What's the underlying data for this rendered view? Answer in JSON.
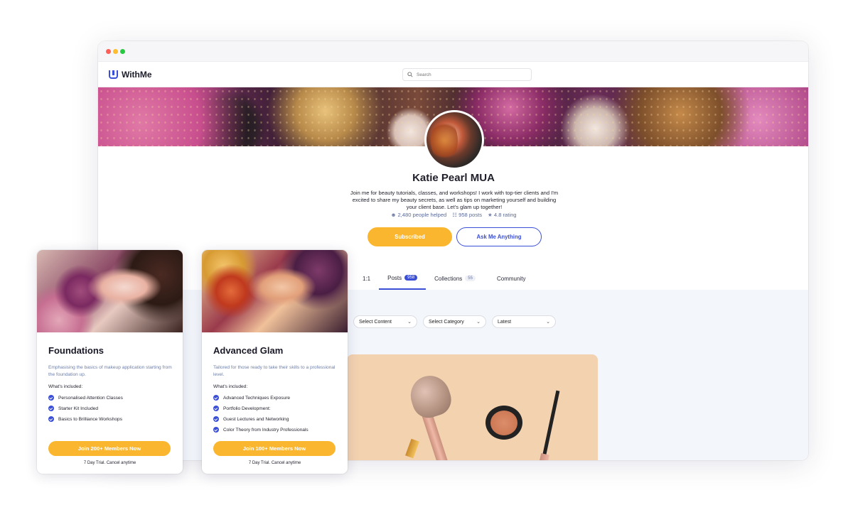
{
  "app": {
    "name": "WithMe"
  },
  "search": {
    "placeholder": "Search"
  },
  "profile": {
    "name": "Katie Pearl MUA",
    "bio": "Join me for beauty tutorials, classes, and workshops! I work with top-tier clients and I'm excited to share my beauty secrets, as well as tips on marketing yourself and building your client base. Let's glam up together!",
    "stats": {
      "helped": "2,480 people helped",
      "posts": "958 posts",
      "rating": "4.8 rating"
    }
  },
  "actions": {
    "subscribed": "Subscribed",
    "ask": "Ask Me Anything"
  },
  "tabs": [
    {
      "label": "1:1",
      "badge": ""
    },
    {
      "label": "Posts",
      "badge": "958"
    },
    {
      "label": "Collections",
      "badge": "55"
    },
    {
      "label": "Community",
      "badge": ""
    }
  ],
  "filters": {
    "content": "Select Content",
    "category": "Select Category",
    "sort": "Latest"
  },
  "cards": [
    {
      "title": "Foundations",
      "description": "Emphasising the basics of makeup application starting from the foundation up.",
      "included_label": "What's included:",
      "features": [
        "Personalised Attention Classes",
        "Starter Kit Included",
        "Basics to Brilliance Workshops"
      ],
      "cta": "Join 200+ Members Now",
      "trial": "7 Day Trial. Cancel anytime"
    },
    {
      "title": "Advanced Glam",
      "description": "Tailored for those ready to take their skills to a professional level.",
      "included_label": "What's included:",
      "features": [
        "Advanced Techniques Exposure",
        "Portfolio Development:",
        "Guest Lectures and Networking",
        "Color Theory from Industry Professionals"
      ],
      "cta": "Join 100+ Members Now",
      "trial": "7 Day Trial. Cancel anytime"
    }
  ],
  "colors": {
    "accent": "#3b4fd6",
    "cta": "#fbb630",
    "muted": "#6e7fa8"
  }
}
